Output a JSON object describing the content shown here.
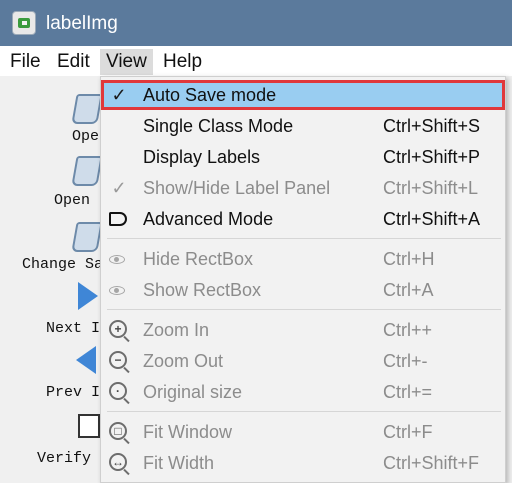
{
  "window": {
    "title": "labelImg",
    "app_icon": "labelimg-app-icon"
  },
  "menubar": {
    "items": [
      {
        "label": "File"
      },
      {
        "label": "Edit"
      },
      {
        "label": "View"
      },
      {
        "label": "Help"
      }
    ],
    "active": "View"
  },
  "toolbar": {
    "items": [
      {
        "label": "Ope",
        "icon": "folder-icon"
      },
      {
        "label": "Open ",
        "icon": "folder-icon"
      },
      {
        "label": "Change Sa",
        "icon": "folder-icon"
      },
      {
        "label": "Next I",
        "icon": "next-arrow-icon"
      },
      {
        "label": "Prev I",
        "icon": "prev-arrow-icon"
      },
      {
        "label": "Verify ",
        "icon": "verify-check-icon"
      }
    ]
  },
  "view_menu": {
    "items": [
      {
        "label": "Auto Save mode",
        "shortcut": "",
        "icon": "check-icon",
        "checked": true,
        "enabled": true,
        "highlighted": true
      },
      {
        "label": "Single Class Mode",
        "shortcut": "Ctrl+Shift+S",
        "icon": "",
        "enabled": true
      },
      {
        "label": "Display Labels",
        "shortcut": "Ctrl+Shift+P",
        "icon": "",
        "enabled": true
      },
      {
        "label": "Show/Hide Label Panel",
        "shortcut": "Ctrl+Shift+L",
        "icon": "check-icon",
        "checked": true,
        "enabled": false
      },
      {
        "label": "Advanced Mode",
        "shortcut": "Ctrl+Shift+A",
        "icon": "tag-icon",
        "enabled": true
      },
      {
        "label": "Hide RectBox",
        "shortcut": "Ctrl+H",
        "icon": "eye-icon",
        "enabled": false
      },
      {
        "label": "Show RectBox",
        "shortcut": "Ctrl+A",
        "icon": "eye-icon",
        "enabled": false
      },
      {
        "label": "Zoom In",
        "shortcut": "Ctrl++",
        "icon": "zoom-in-icon",
        "enabled": false
      },
      {
        "label": "Zoom Out",
        "shortcut": "Ctrl+-",
        "icon": "zoom-out-icon",
        "enabled": false
      },
      {
        "label": "Original size",
        "shortcut": "Ctrl+=",
        "icon": "zoom-original-icon",
        "enabled": false
      },
      {
        "label": "Fit Window",
        "shortcut": "Ctrl+F",
        "icon": "fit-window-icon",
        "enabled": false
      },
      {
        "label": "Fit Width",
        "shortcut": "Ctrl+Shift+F",
        "icon": "fit-width-icon",
        "enabled": false
      }
    ]
  },
  "colors": {
    "titlebar": "#5b7a9c",
    "menu_highlight": "#99cdf1",
    "highlight_outline": "#e0383b",
    "disabled_text": "#8c8c8c"
  }
}
